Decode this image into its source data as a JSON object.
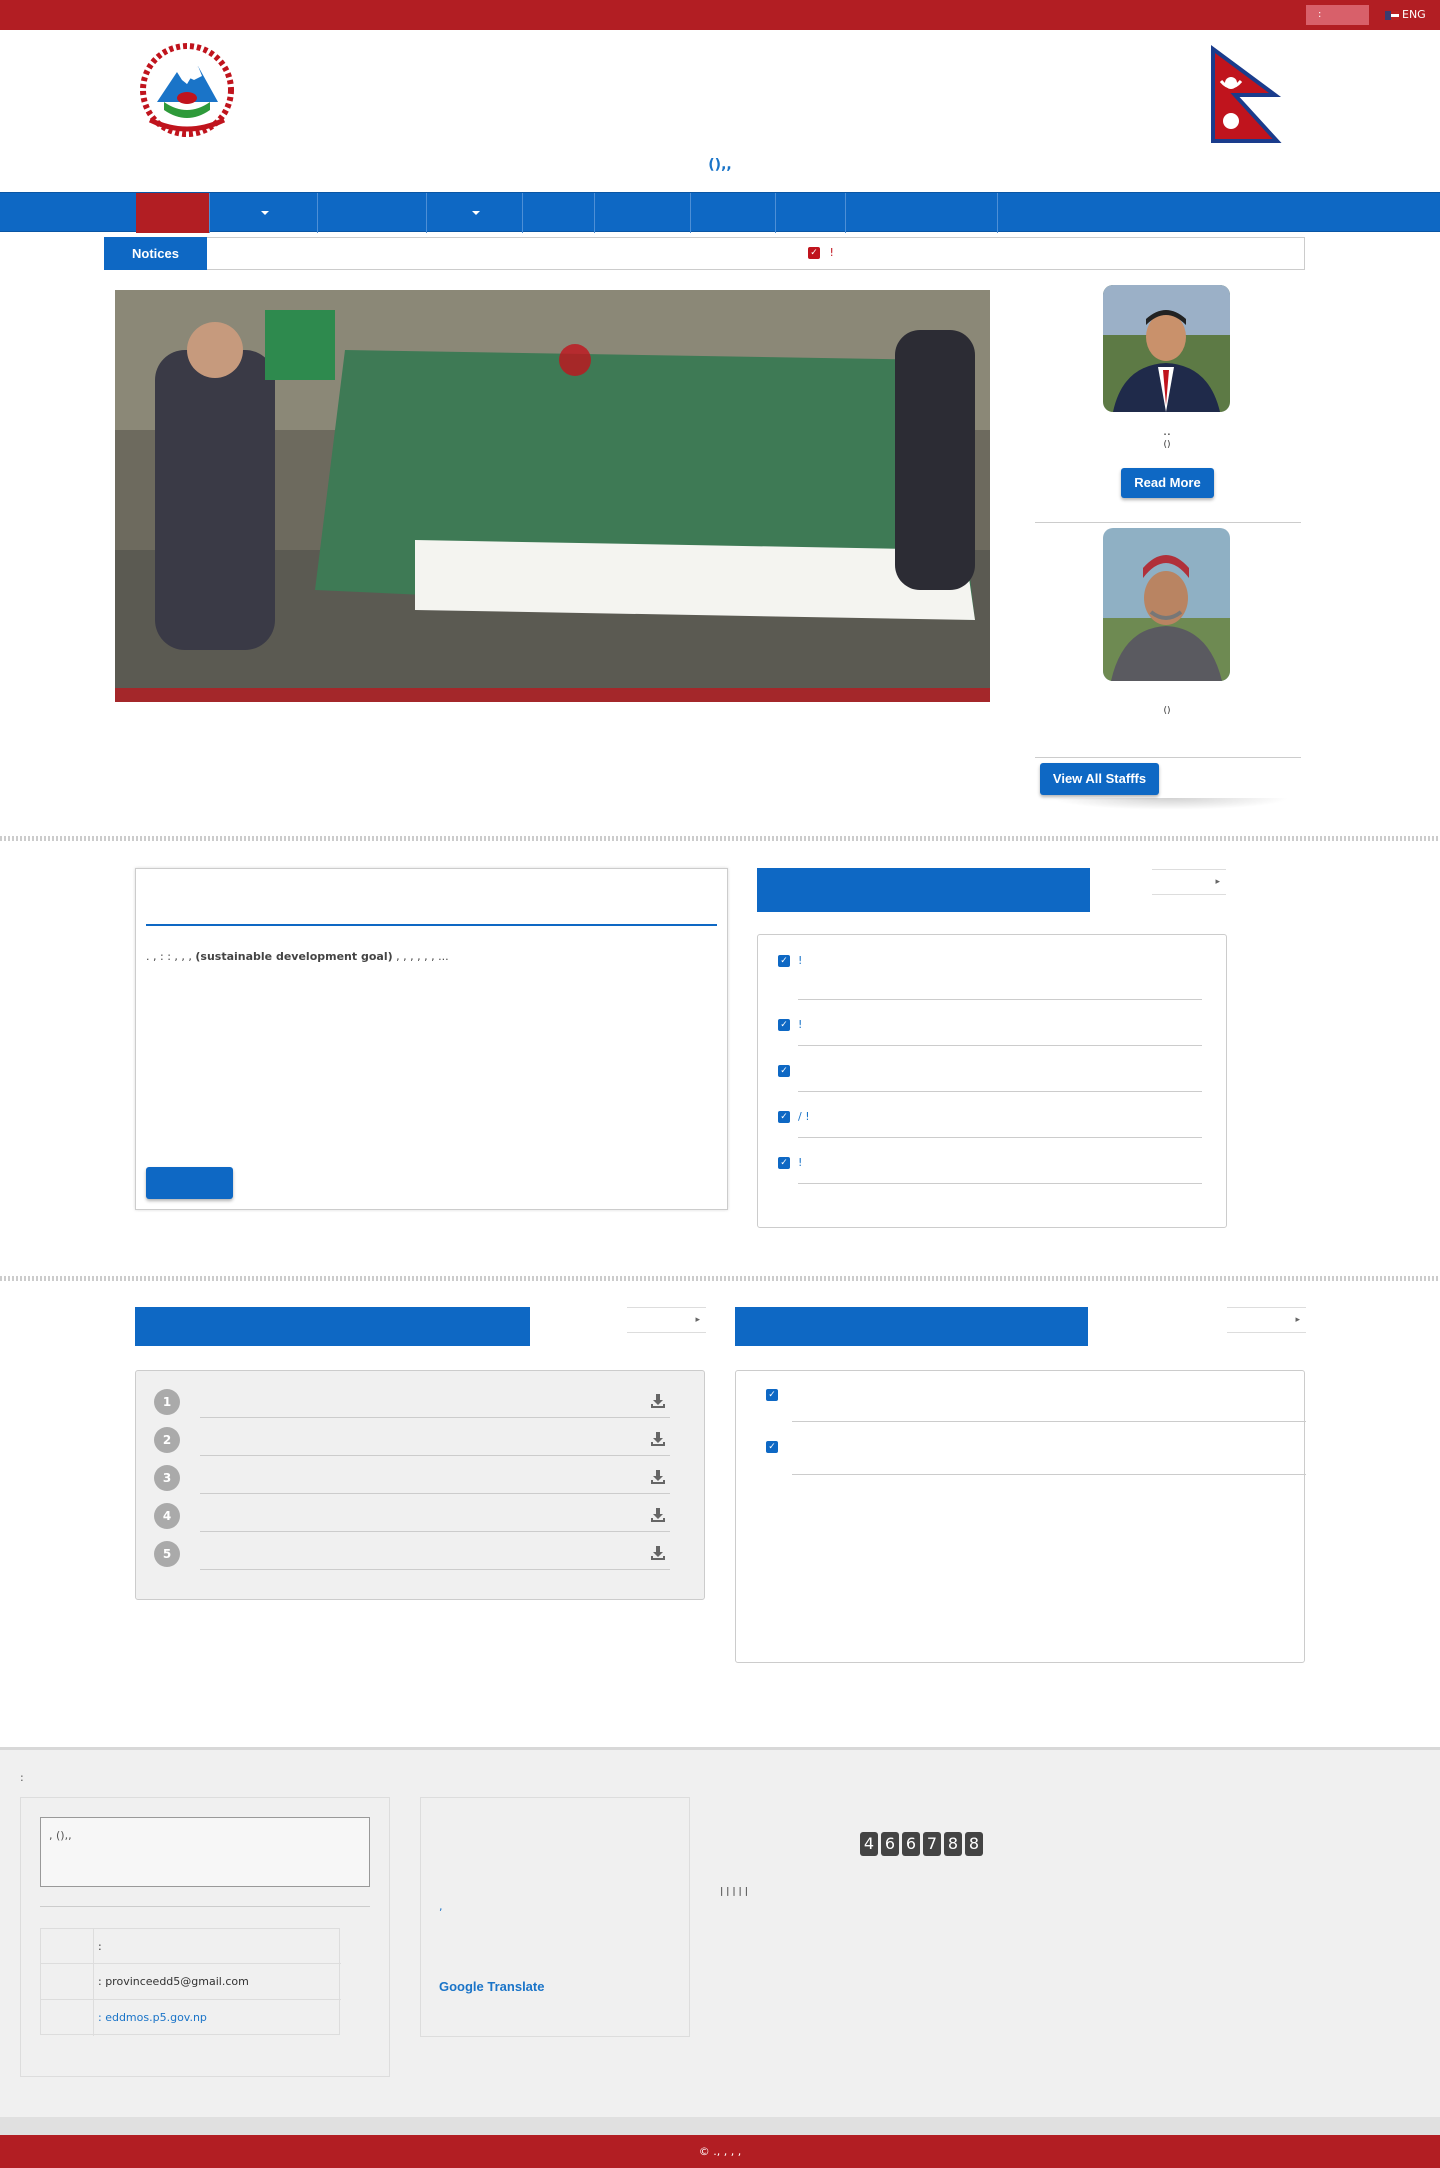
{
  "topbar": {
    "lang_selected": ":  ",
    "lang_eng": "ENG"
  },
  "header": {
    "line1": "  ",
    "line2": " ",
    "line3": "    ",
    "line4": "    ",
    "line5": "  (),,"
  },
  "nav": {
    "items": [
      {
        "label": ""
      },
      {
        "label": "  "
      },
      {
        "label": " "
      },
      {
        "label": ""
      },
      {
        "label": ""
      },
      {
        "label": " "
      },
      {
        "label": ""
      },
      {
        "label": ""
      },
      {
        "label": "  "
      }
    ]
  },
  "notices": {
    "label": "Notices",
    "marquee": "           !"
  },
  "slider": {
    "caption": "    "
  },
  "staff": [
    {
      "name": " .. ",
      "post": "()",
      "button": "Read More"
    },
    {
      "name": "  ",
      "post": "()"
    }
  ],
  "staff_all_button": "View All Stafffs",
  "about": {
    "title": " ",
    "text_a": "        .               ,                     :           : ,   ,  ,                     ",
    "sdg": "(sustainable development goal)",
    "text_b": "  ,    ,                 ,  , ,                ,           ...",
    "button": " "
  },
  "notice_panel": {
    "title": "",
    "more": " ",
    "items": [
      "             !",
      "        !",
      "      ",
      " /      !",
      "         !"
    ]
  },
  "downloads": {
    "title": " ",
    "more": " ",
    "items": [
      {
        "num": "1",
        "text": "    "
      },
      {
        "num": "2",
        "text": "      "
      },
      {
        "num": "3",
        "text": "         "
      },
      {
        "num": "4",
        "text": "          "
      },
      {
        "num": "5",
        "text": "       "
      }
    ]
  },
  "press": {
    "title": "",
    "more": " ",
    "items": [
      "             ",
      "           "
    ]
  },
  "footer": {
    "contact_head": " :",
    "address_line1": "    ",
    "address_line2": "  ,  (),,",
    "address_line3": "",
    "phone_label": "",
    "phone_value": ":",
    "email_label": "",
    "email_value": ": provinceedd5@gmail.com",
    "web_label": "",
    "web_value": ": eddmos.p5.gov.np",
    "links_head": "  ",
    "links": [
      "   ",
      "    ",
      "  ,  ",
      "  "
    ],
    "google_translate": "Google Translate",
    "counter_head": "  ",
    "counter_digits": [
      "4",
      "6",
      "6",
      "7",
      "8",
      "8"
    ],
    "bottom_links": [
      "  ",
      "",
      "  ",
      "      ",
      "  ",
      " "
    ]
  },
  "copyright": " © ., ,    ,  ,  ",
  "colors": {
    "brand_red": "#b21e23",
    "brand_blue": "#0e68c4"
  }
}
